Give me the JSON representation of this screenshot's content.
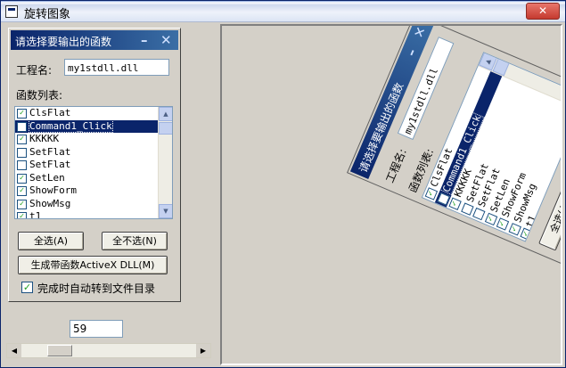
{
  "window": {
    "title": "旋转图象"
  },
  "form": {
    "title": "请选择要输出的函数",
    "project_label": "工程名:",
    "project_value": "my1stdll.dll",
    "functions_label": "函数列表:",
    "functions": [
      {
        "name": "ClsFlat",
        "checked": true
      },
      {
        "name": "Command1_Click",
        "checked": false,
        "selected": true
      },
      {
        "name": "KKKKK",
        "checked": true
      },
      {
        "name": "SetFlat",
        "checked": false
      },
      {
        "name": "SetFlat",
        "checked": false
      },
      {
        "name": "SetLen",
        "checked": true
      },
      {
        "name": "ShowForm",
        "checked": true
      },
      {
        "name": "ShowMsg",
        "checked": true
      },
      {
        "name": "t1",
        "checked": true
      }
    ],
    "select_all_label": "全选(A)",
    "deselect_all_label": "全不选(N)",
    "generate_label": "生成带函数ActiveX DLL(M)",
    "auto_open_label": "完成时自动转到文件目录",
    "auto_open_checked": true
  },
  "rotation": {
    "value": "59"
  },
  "icons": {
    "minimize": "minimize-icon",
    "close": "close-icon",
    "app": "app-icon"
  }
}
